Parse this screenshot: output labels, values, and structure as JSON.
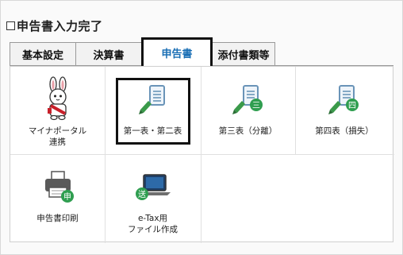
{
  "header": {
    "checkbox_checked": false,
    "title": "申告書入力完了"
  },
  "tabs": [
    {
      "label": "基本設定",
      "active": false
    },
    {
      "label": "決算書",
      "active": false
    },
    {
      "label": "申告書",
      "active": true
    },
    {
      "label": "添付書類等",
      "active": false
    }
  ],
  "tiles": [
    {
      "label": "マイナポータル\n連携",
      "icon": "mynaportal-rabbit-icon"
    },
    {
      "label": "第一表・第二表",
      "icon": "document-edit-icon"
    },
    {
      "label": "第三表（分離）",
      "icon": "document-edit-badge-icon",
      "badge": "三"
    },
    {
      "label": "第四表（損失）",
      "icon": "document-edit-badge-icon",
      "badge": "四"
    },
    {
      "label": "申告書印刷",
      "icon": "printer-icon",
      "badge": "申"
    },
    {
      "label": "e-Tax用\nファイル作成",
      "icon": "laptop-icon",
      "badge": "送"
    }
  ],
  "colors": {
    "active_tab_text": "#1a6fb5",
    "doc_blue": "#6a94b8",
    "pencil_green": "#3a9a4a",
    "badge_green": "#2f9e50",
    "rabbit_red": "#c8202a"
  }
}
